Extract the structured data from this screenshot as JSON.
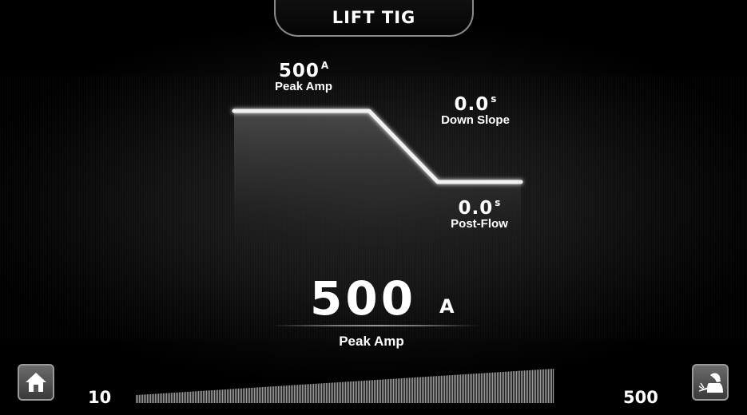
{
  "mode": {
    "title": "LIFT TIG"
  },
  "profile": {
    "peak": {
      "value": "500",
      "unit": "A",
      "label": "Peak Amp"
    },
    "down_slope": {
      "value": "0.0",
      "unit": "s",
      "label": "Down Slope"
    },
    "post_flow": {
      "value": "0.0",
      "unit": "s",
      "label": "Post-Flow"
    }
  },
  "readout": {
    "value": "500",
    "unit": "A",
    "label": "Peak Amp"
  },
  "scale": {
    "min": "10",
    "max": "500",
    "level_fraction": 1.0
  },
  "buttons": {
    "home_icon": "home-icon",
    "weld_icon": "welder-icon"
  }
}
